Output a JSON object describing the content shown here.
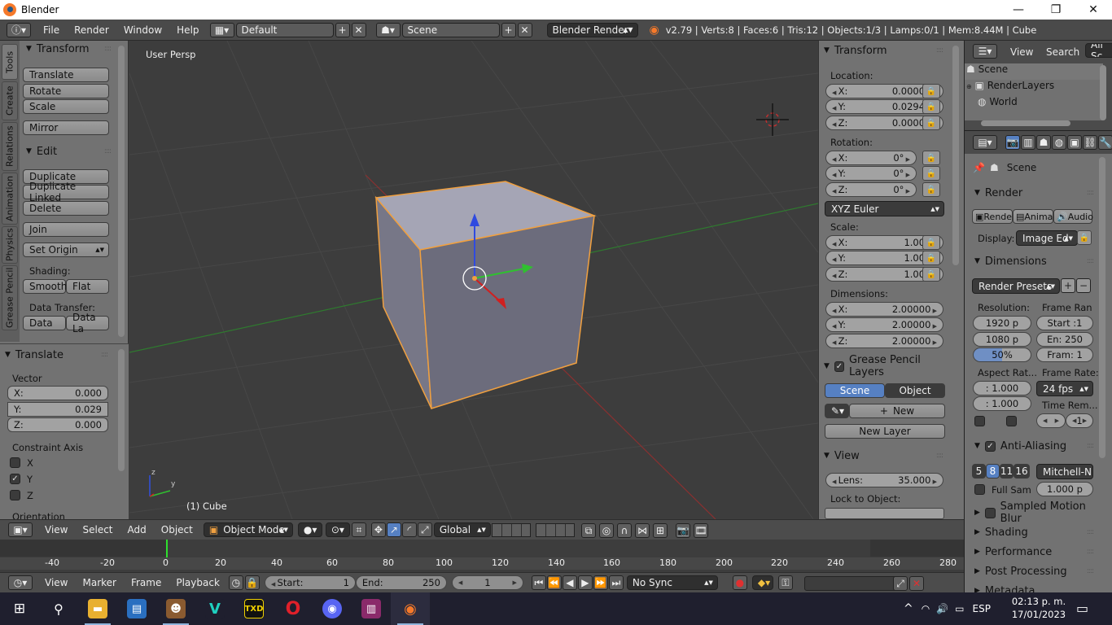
{
  "window": {
    "title": "Blender",
    "minimize": "—",
    "maximize": "❐",
    "close": "✕"
  },
  "infobar": {
    "menus": [
      "File",
      "Render",
      "Window",
      "Help"
    ],
    "layout": "Default",
    "scene": "Scene",
    "engine": "Blender Render",
    "stats": "v2.79 | Verts:8 | Faces:6 | Tris:12 | Objects:1/3 | Lamps:0/1 | Mem:8.44M | Cube"
  },
  "toolshelf": {
    "tabs": [
      "Tools",
      "Create",
      "Relations",
      "Animation",
      "Physics",
      "Grease Pencil"
    ],
    "transform": {
      "title": "Transform",
      "translate": "Translate",
      "rotate": "Rotate",
      "scale": "Scale",
      "mirror": "Mirror"
    },
    "edit": {
      "title": "Edit",
      "duplicate": "Duplicate",
      "duplicate_linked": "Duplicate Linked",
      "delete": "Delete",
      "join": "Join",
      "set_origin": "Set Origin",
      "shading": "Shading:",
      "smooth": "Smooth",
      "flat": "Flat",
      "data_transfer": "Data Transfer:",
      "data": "Data",
      "data_la": "Data La"
    }
  },
  "operator": {
    "title": "Translate",
    "vector": "Vector",
    "x_label": "X:",
    "x": "0.000",
    "y_label": "Y:",
    "y": "0.029",
    "z_label": "Z:",
    "z": "0.000",
    "constraint": "Constraint Axis",
    "cx": "X",
    "cy": "Y",
    "cz": "Z",
    "orientation": "Orientation"
  },
  "viewport": {
    "label": "User Persp",
    "object": "(1) Cube",
    "axis_x": "x",
    "axis_y": "y",
    "axis_z": "z"
  },
  "npanel": {
    "transform": "Transform",
    "location": "Location:",
    "loc": {
      "x": "0.00000",
      "y": "0.02941",
      "z": "0.00000"
    },
    "rotation": "Rotation:",
    "rot": {
      "x": "0°",
      "y": "0°",
      "z": "0°"
    },
    "euler": "XYZ Euler",
    "scale_label": "Scale:",
    "scl": {
      "x": "1.000",
      "y": "1.000",
      "z": "1.000"
    },
    "dimensions": "Dimensions:",
    "dim": {
      "x": "2.00000",
      "y": "2.00000",
      "z": "2.00000"
    },
    "x": "X:",
    "y": "Y:",
    "z": "Z:",
    "gp_layers": "Grease Pencil Layers",
    "scene": "Scene",
    "object": "Object",
    "new": "New",
    "new_layer": "New Layer",
    "view": "View",
    "lens_label": "Lens:",
    "lens": "35.000",
    "lock_obj": "Lock to Object:"
  },
  "outliner": {
    "view": "View",
    "search": "Search",
    "all": "All Sc",
    "scene": "Scene",
    "renderlayers": "RenderLayers",
    "world": "World"
  },
  "properties": {
    "scene": "Scene",
    "render": "Render",
    "rende": "Rende",
    "anima": "Anima",
    "audio": "Audio",
    "display_label": "Display:",
    "display": "Image Ed",
    "dimensions": "Dimensions",
    "presets": "Render Presets",
    "resolution": "Resolution:",
    "frame_range": "Frame Ran",
    "res_x": "1920 p",
    "res_y": "1080 p",
    "res_pct": "50%",
    "start": "Start :1",
    "end": "En: 250",
    "frame": "Fram: 1",
    "aspect": "Aspect Rat...",
    "frame_rate": "Frame Rate:",
    "asp_x": ": 1.000",
    "asp_y": ": 1.000",
    "fps": "24 fps",
    "time_rem": "Time Rem...",
    "time_val": "1",
    "anti_aliasing": "Anti-Aliasing",
    "aa_samples": [
      "5",
      "8",
      "11",
      "16"
    ],
    "filter": "Mitchell-N",
    "full_sam": "Full Sam",
    "filter_size": "1.000 p",
    "sampled_motion": "Sampled Motion Blur",
    "shading": "Shading",
    "performance": "Performance",
    "post_processing": "Post Processing",
    "metadata": "Metadata"
  },
  "header3d": {
    "view": "View",
    "select": "Select",
    "add": "Add",
    "object": "Object",
    "mode": "Object Mode",
    "orientation": "Global"
  },
  "timeline": {
    "ticks": [
      "-40",
      "-20",
      "0",
      "20",
      "40",
      "60",
      "80",
      "100",
      "120",
      "140",
      "160",
      "180",
      "200",
      "220",
      "240",
      "260",
      "280"
    ],
    "view": "View",
    "marker": "Marker",
    "frame": "Frame",
    "playback": "Playback",
    "start_label": "Start:",
    "start": "1",
    "end_label": "End:",
    "end": "250",
    "current": "1",
    "sync": "No Sync"
  },
  "taskbar": {
    "lang": "ESP",
    "time": "02:13 p. m.",
    "date": "17/01/2023",
    "tray_caret": "^",
    "txd": "TXD",
    "vlc": "V"
  }
}
